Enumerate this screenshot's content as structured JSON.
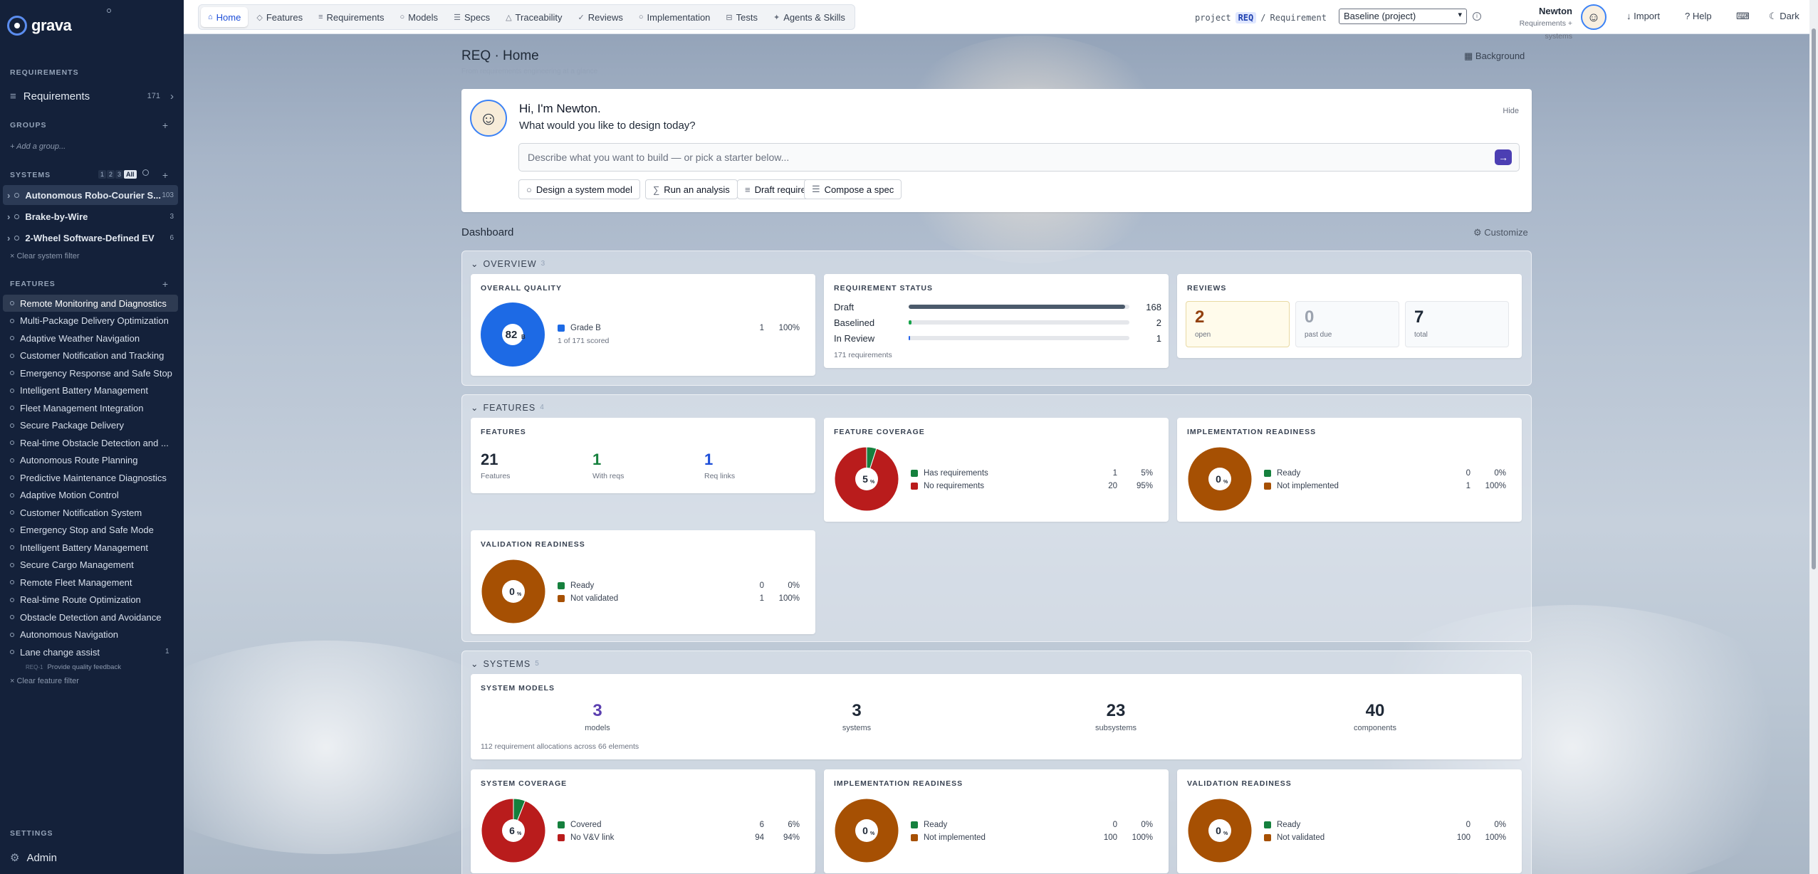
{
  "app": {
    "name": "grava"
  },
  "sidebar": {
    "requirements_heading": "REQUIREMENTS",
    "requirements_item": {
      "label": "Requirements",
      "count": "171"
    },
    "groups_heading": "GROUPS",
    "add_group_placeholder": "+ Add a group...",
    "systems_heading": "SYSTEMS",
    "systems_levels": [
      "1",
      "2",
      "3",
      "All"
    ],
    "systems": [
      {
        "label": "Autonomous Robo-Courier S...",
        "count": "103"
      },
      {
        "label": "Brake-by-Wire",
        "count": "3"
      },
      {
        "label": "2-Wheel Software-Defined EV",
        "count": "6"
      }
    ],
    "clear_system_filter": "× Clear system filter",
    "features_heading": "FEATURES",
    "features": [
      "Remote Monitoring and Diagnostics",
      "Multi-Package Delivery Optimization",
      "Adaptive Weather Navigation",
      "Customer Notification and Tracking",
      "Emergency Response and Safe Stop",
      "Intelligent Battery Management",
      "Fleet Management Integration",
      "Secure Package Delivery",
      "Real-time Obstacle Detection and ...",
      "Autonomous Route Planning",
      "Predictive Maintenance Diagnostics",
      "Adaptive Motion Control",
      "Customer Notification System",
      "Emergency Stop and Safe Mode",
      "Intelligent Battery Management",
      "Secure Cargo Management",
      "Remote Fleet Management",
      "Real-time Route Optimization",
      "Obstacle Detection and Avoidance",
      "Autonomous Navigation",
      "Lane change assist"
    ],
    "lane_change_count": "1",
    "lane_change_sub": {
      "id": "REQ-1",
      "label": "Provide quality feedback"
    },
    "clear_feature_filter": "× Clear feature filter",
    "settings_heading": "SETTINGS",
    "admin_label": "Admin"
  },
  "topbar": {
    "tabs": [
      {
        "label": "Home",
        "icon": "home-icon",
        "glyph": "⌂"
      },
      {
        "label": "Features",
        "icon": "feature-icon",
        "glyph": "◇"
      },
      {
        "label": "Requirements",
        "icon": "list-icon",
        "glyph": "≡"
      },
      {
        "label": "Models",
        "icon": "model-icon",
        "glyph": "○"
      },
      {
        "label": "Specs",
        "icon": "spec-icon",
        "glyph": "☰"
      },
      {
        "label": "Traceability",
        "icon": "trace-icon",
        "glyph": "△"
      },
      {
        "label": "Reviews",
        "icon": "check-icon",
        "glyph": "✓"
      },
      {
        "label": "Implementation",
        "icon": "impl-icon",
        "glyph": "○"
      },
      {
        "label": "Tests",
        "icon": "test-icon",
        "glyph": "⊟"
      },
      {
        "label": "Agents & Skills",
        "icon": "agent-icon",
        "glyph": "✦"
      }
    ],
    "crumb_project": "project",
    "crumb_req": "REQ",
    "crumb_sep": "/",
    "crumb_type": "Requirement",
    "baseline": "Baseline (project)",
    "user_name": "Newton",
    "user_role": "Requirements + systems",
    "import": "Import",
    "help": "Help",
    "theme": "Dark"
  },
  "page": {
    "title": "REQ · Home",
    "subtitle": "From requirements engineering at a glance",
    "background_btn": "Background"
  },
  "newton": {
    "greeting": "Hi, I'm Newton.",
    "question": "What would you like to design today?",
    "hide": "Hide",
    "placeholder": "Describe what you want to build — or pick a starter below...",
    "starters": [
      {
        "label": "Design a system model",
        "glyph": "○"
      },
      {
        "label": "Run an analysis",
        "glyph": "∑"
      },
      {
        "label": "Draft requirements",
        "glyph": "≡"
      },
      {
        "label": "Compose a spec",
        "glyph": "☰"
      }
    ]
  },
  "dashboard": {
    "title": "Dashboard",
    "customize": "Customize"
  },
  "overview": {
    "label": "OVERVIEW",
    "count": "3",
    "quality": {
      "title": "OVERALL QUALITY",
      "score": "82",
      "grade": "B",
      "legend": "Grade B",
      "count": "1",
      "pct": "100%",
      "scored": "1 of 171 scored",
      "color": "#1d6ae5"
    },
    "status": {
      "title": "REQUIREMENT STATUS",
      "rows": [
        {
          "label": "Draft",
          "value": "168",
          "fraction": 0.982,
          "color": "#4b5a6b"
        },
        {
          "label": "Baselined",
          "value": "2",
          "fraction": 0.012,
          "color": "#16a34a"
        },
        {
          "label": "In Review",
          "value": "1",
          "fraction": 0.006,
          "color": "#2563eb"
        }
      ],
      "total": "171 requirements"
    },
    "reviews": {
      "title": "REVIEWS",
      "items": [
        {
          "value": "2",
          "label": "open"
        },
        {
          "value": "0",
          "label": "past due"
        },
        {
          "value": "7",
          "label": "total"
        }
      ]
    }
  },
  "features": {
    "label": "FEATURES",
    "count": "4",
    "stats": {
      "title": "FEATURES",
      "items": [
        {
          "value": "21",
          "label": "Features",
          "color": "#1f2937"
        },
        {
          "value": "1",
          "label": "With reqs",
          "color": "#15803d"
        },
        {
          "value": "1",
          "label": "Req links",
          "color": "#1d4ed8"
        }
      ]
    },
    "coverage": {
      "title": "FEATURE COVERAGE",
      "center": "5",
      "unit": "%",
      "slices": [
        {
          "label": "Has requirements",
          "count": "1",
          "pct": "5%",
          "value": 5,
          "color": "#15803d"
        },
        {
          "label": "No requirements",
          "count": "20",
          "pct": "95%",
          "value": 95,
          "color": "#b91c1c"
        }
      ]
    },
    "impl": {
      "title": "IMPLEMENTATION READINESS",
      "center": "0",
      "unit": "%",
      "slices": [
        {
          "label": "Ready",
          "count": "0",
          "pct": "0%",
          "value": 0,
          "color": "#15803d"
        },
        {
          "label": "Not implemented",
          "count": "1",
          "pct": "100%",
          "value": 100,
          "color": "#a65003"
        }
      ]
    },
    "valid": {
      "title": "VALIDATION READINESS",
      "center": "0",
      "unit": "%",
      "slices": [
        {
          "label": "Ready",
          "count": "0",
          "pct": "0%",
          "value": 0,
          "color": "#15803d"
        },
        {
          "label": "Not validated",
          "count": "1",
          "pct": "100%",
          "value": 100,
          "color": "#a65003"
        }
      ]
    }
  },
  "systems": {
    "label": "SYSTEMS",
    "count": "5",
    "models": {
      "title": "SYSTEM MODELS",
      "items": [
        {
          "value": "3",
          "label": "models",
          "color": "#5b3fb0"
        },
        {
          "value": "3",
          "label": "systems",
          "color": "#1f2937"
        },
        {
          "value": "23",
          "label": "subsystems",
          "color": "#1f2937"
        },
        {
          "value": "40",
          "label": "components",
          "color": "#1f2937"
        }
      ],
      "note": "112 requirement allocations across 66 elements"
    },
    "coverage": {
      "title": "SYSTEM COVERAGE",
      "center": "6",
      "unit": "%",
      "slices": [
        {
          "label": "Covered",
          "count": "6",
          "pct": "6%",
          "value": 6,
          "color": "#15803d"
        },
        {
          "label": "No V&V link",
          "count": "94",
          "pct": "94%",
          "value": 94,
          "color": "#b91c1c"
        }
      ]
    },
    "impl": {
      "title": "IMPLEMENTATION READINESS",
      "center": "0",
      "unit": "%",
      "slices": [
        {
          "label": "Ready",
          "count": "0",
          "pct": "0%",
          "value": 0,
          "color": "#15803d"
        },
        {
          "label": "Not implemented",
          "count": "100",
          "pct": "100%",
          "value": 100,
          "color": "#a65003"
        }
      ]
    },
    "valid": {
      "title": "VALIDATION READINESS",
      "center": "0",
      "unit": "%",
      "slices": [
        {
          "label": "Ready",
          "count": "0",
          "pct": "0%",
          "value": 0,
          "color": "#15803d"
        },
        {
          "label": "Not validated",
          "count": "100",
          "pct": "100%",
          "value": 100,
          "color": "#a65003"
        }
      ]
    }
  }
}
